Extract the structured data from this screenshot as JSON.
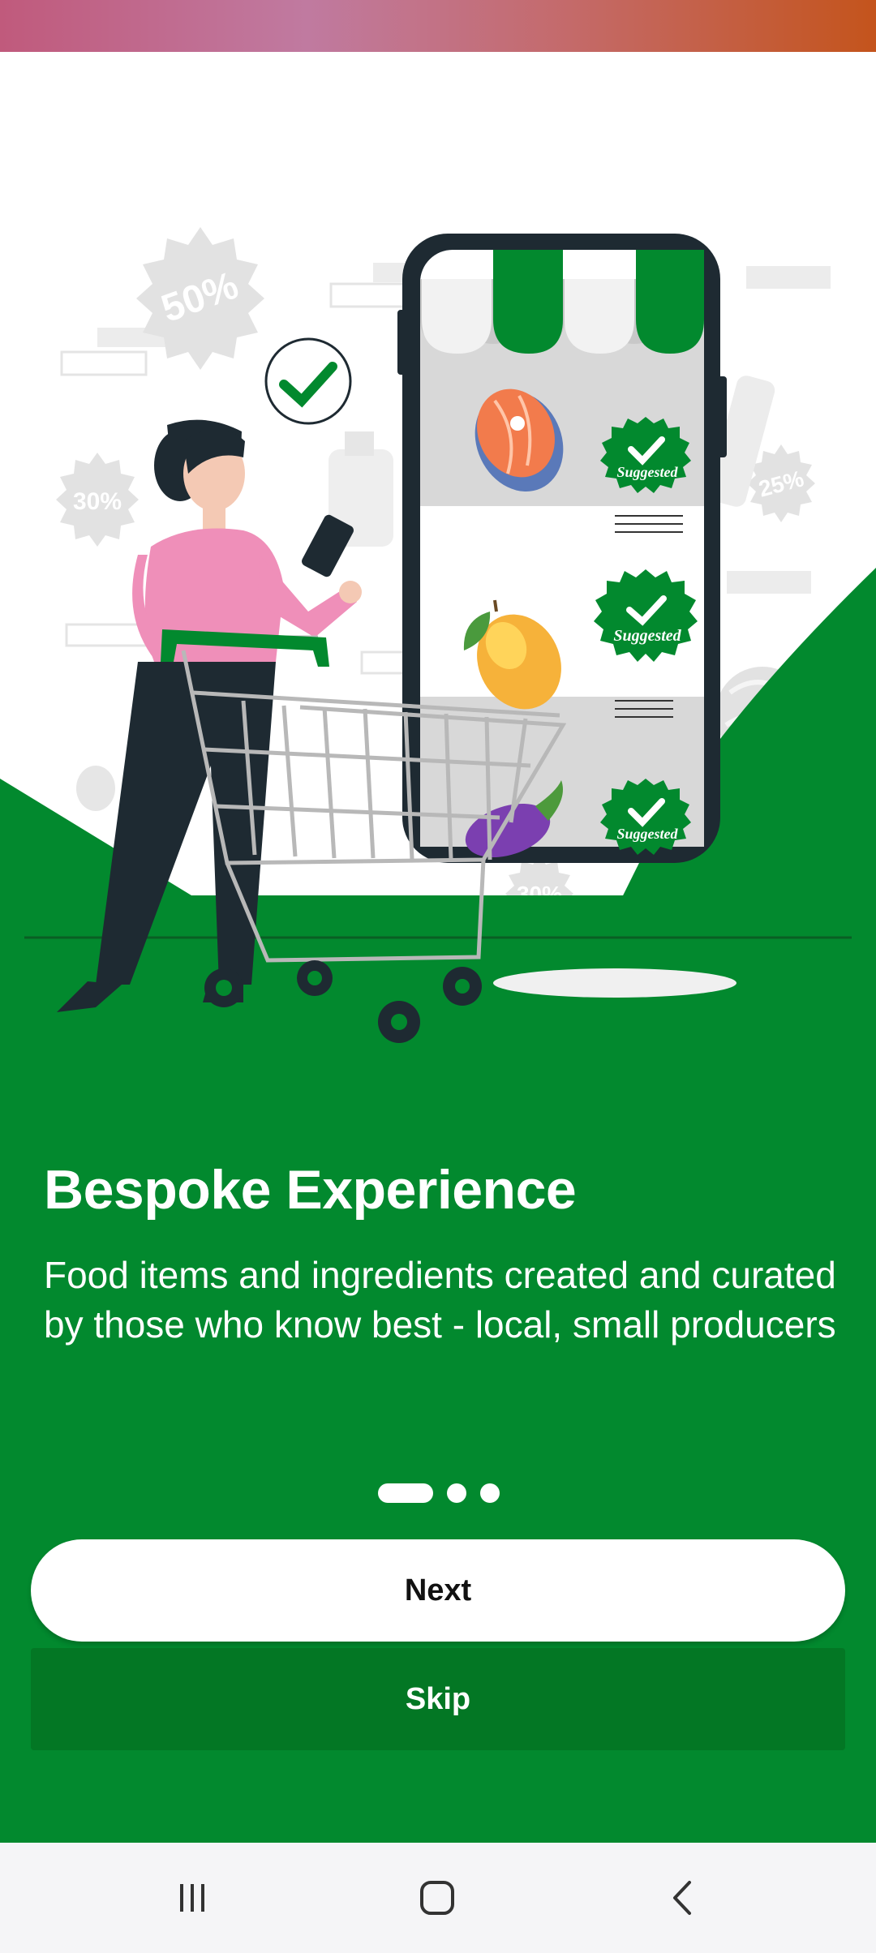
{
  "onboarding": {
    "title": "Bespoke Experience",
    "description": "Food items and ingredients created and curated by those who know best - local, small producers",
    "page_indicator": {
      "total": 3,
      "current": 1
    },
    "next_label": "Next",
    "skip_label": "Skip"
  },
  "illustration": {
    "badge_label": "Suggested",
    "discount_tags": [
      "50%",
      "30%",
      "25%",
      "30%"
    ]
  },
  "nav": {
    "recents_icon": "recents-icon",
    "home_icon": "home-icon",
    "back_icon": "back-icon"
  },
  "colors": {
    "brand_green": "#02892e",
    "skip_green": "#037724",
    "phone_frame": "#1e2a32",
    "shirt_pink": "#ef8fb9"
  }
}
